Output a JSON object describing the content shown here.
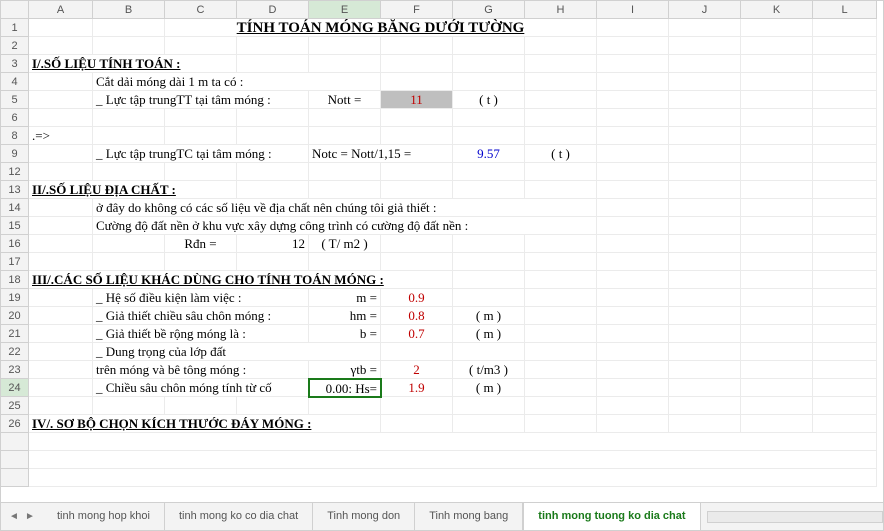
{
  "columns": [
    "A",
    "B",
    "C",
    "D",
    "E",
    "F",
    "G",
    "H",
    "I",
    "J",
    "K",
    "L"
  ],
  "rows": [
    "1",
    "2",
    "3",
    "4",
    "5",
    "6",
    "8",
    "9",
    "12",
    "13",
    "14",
    "15",
    "16",
    "17",
    "18",
    "19",
    "20",
    "21",
    "22",
    "23",
    "24",
    "25",
    "26"
  ],
  "selected_col": "E",
  "selected_row": "24",
  "title": "TÍNH TOÁN MÓNG BĂNG DƯỚI TƯỜNG",
  "sec1": "I/.SỐ LIỆU TÍNH TOÁN :",
  "r4": "Cắt dải móng dài 1 m ta có :",
  "r5_label": "_ Lực tập trungTT tại tâm móng :",
  "r5_sym": "Nott  =",
  "r5_val": "11",
  "r5_unit": "( t )",
  "r8": ".=>",
  "r9_label": "_ Lực tập trungTC tại tâm móng :",
  "r9_sym": "Notc  = Nott/1,15  =",
  "r9_val": "9.57",
  "r9_unit": "( t )",
  "sec2": "II/.SỐ LIỆU ĐỊA CHẤT :",
  "r14": "ở đây do không có các số liệu về địa chất  nên chúng tôi giả thiết :",
  "r15": "Cường độ đất nền ở khu vực xây dựng công trình có cường độ đất nền :",
  "r16_sym": "Rđn =",
  "r16_val": "12",
  "r16_unit": "( T/ m2 )",
  "sec3": "III/.CÁC SỐ LIỆU KHÁC DÙNG CHO TÍNH TOÁN MÓNG :",
  "r19_label": "_ Hệ số điều kiện làm việc :",
  "r19_sym": "m =",
  "r19_val": "0.9",
  "r20_label": "_ Giả thiết chiều sâu chôn móng :",
  "r20_sym": "hm =",
  "r20_val": "0.8",
  "r20_unit": "( m )",
  "r21_label": "_ Giả thiết bề rộng móng là :",
  "r21_sym": "b =",
  "r21_val": "0.7",
  "r21_unit": "( m )",
  "r22_label": "_ Dung trọng của lớp đất",
  "r23_label": "   trên móng và bê tông móng :",
  "r23_sym": "γtb =",
  "r23_val": "2",
  "r23_unit": "( t/m3 )",
  "r24_label": "_ Chiều sâu chôn móng tính từ cố",
  "r24_sym": "0.00: Hs=",
  "r24_val": "1.9",
  "r24_unit": "( m )",
  "sec4": "IV/. SƠ BỘ CHỌN KÍCH THƯỚC ĐÁY MÓNG :",
  "tabs": [
    {
      "label": "tinh mong hop khoi",
      "active": false
    },
    {
      "label": "tinh mong ko co dia chat",
      "active": false
    },
    {
      "label": "Tinh mong don",
      "active": false
    },
    {
      "label": "Tinh mong bang",
      "active": false
    },
    {
      "label": "tinh mong tuong ko dia chat",
      "active": true
    }
  ]
}
